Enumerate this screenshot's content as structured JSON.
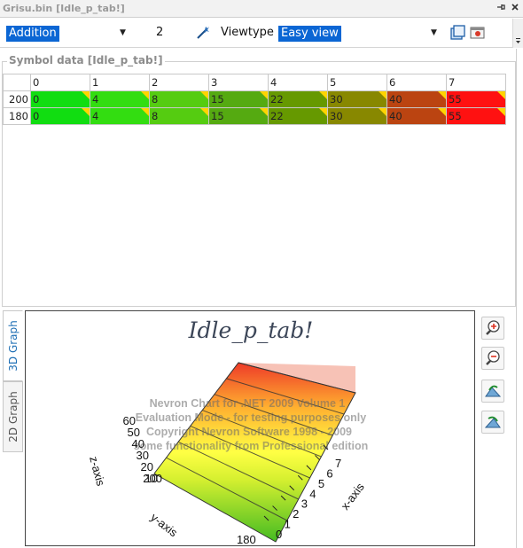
{
  "window": {
    "title": "Grisu.bin [Idle_p_tab!]",
    "pin_icon": "pin-icon",
    "close_icon": "close-icon"
  },
  "toolbar": {
    "mode_value": "Addition",
    "number_value": "2",
    "viewtype_label": "Viewtype",
    "viewtype_value": "Easy view"
  },
  "symbol_data": {
    "title": "Symbol data [Idle_p_tab!]",
    "columns": [
      "0",
      "1",
      "2",
      "3",
      "4",
      "5",
      "6",
      "7"
    ],
    "rows": [
      {
        "label": "200",
        "values": [
          "0",
          "4",
          "8",
          "15",
          "22",
          "30",
          "40",
          "55"
        ]
      },
      {
        "label": "180",
        "values": [
          "0",
          "4",
          "8",
          "15",
          "22",
          "30",
          "40",
          "55"
        ]
      }
    ],
    "cell_colors": [
      "#11dd11",
      "#33dd11",
      "#55cc11",
      "#55aa11",
      "#669900",
      "#888800",
      "#bb4411",
      "#ff1111"
    ]
  },
  "tabs": [
    {
      "label": "3D Graph",
      "active": true
    },
    {
      "label": "2D Graph",
      "active": false
    }
  ],
  "graph": {
    "title": "Idle_p_tab!",
    "watermark": [
      "Nevron Chart for .NET 2009 Volume 1",
      "Evaluation Mode - for testing purposes only",
      "Copyright Nevron Software 1998 - 2009",
      "some functionality from Professional edition"
    ],
    "z_axis": {
      "label": "z-axis",
      "ticks": [
        "60",
        "50",
        "40",
        "30",
        "20",
        "10"
      ]
    },
    "y_axis": {
      "label": "y-axis",
      "ticks": [
        "200",
        "180"
      ]
    },
    "x_axis": {
      "label": "x-axis",
      "ticks": [
        "0",
        "1",
        "2",
        "3",
        "4",
        "5",
        "6",
        "7"
      ]
    }
  },
  "side_buttons": [
    {
      "name": "zoom-in-icon"
    },
    {
      "name": "zoom-out-icon"
    },
    {
      "name": "rotate-left-icon"
    },
    {
      "name": "rotate-right-icon"
    }
  ],
  "chart_data": {
    "type": "surface",
    "title": "Idle_p_tab!",
    "x": [
      "0",
      "1",
      "2",
      "3",
      "4",
      "5",
      "6",
      "7"
    ],
    "y": [
      "200",
      "180"
    ],
    "series": [
      {
        "name": "200",
        "values": [
          0,
          4,
          8,
          15,
          22,
          30,
          40,
          55
        ]
      },
      {
        "name": "180",
        "values": [
          0,
          4,
          8,
          15,
          22,
          30,
          40,
          55
        ]
      }
    ],
    "xlabel": "x-axis",
    "ylabel": "y-axis",
    "zlabel": "z-axis",
    "zlim": [
      10,
      60
    ]
  }
}
